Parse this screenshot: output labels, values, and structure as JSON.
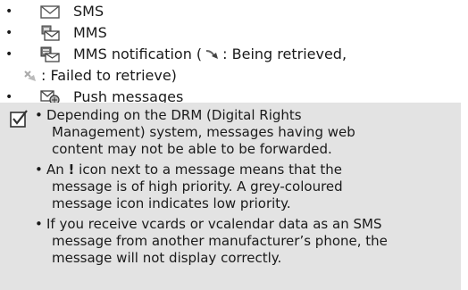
{
  "message_types": [
    {
      "icon": "envelope-icon",
      "label": "SMS"
    },
    {
      "icon": "mms-icon",
      "label": "MMS"
    },
    {
      "icon": "mms-notification-icon",
      "label": "MMS notification (",
      "retrieving_icon": "retrieving-arrow-icon",
      "retrieving_text": ": Being retrieved,",
      "failed_icon": "failed-retrieve-icon",
      "failed_text": ": Failed to retrieve)"
    },
    {
      "icon": "push-message-icon",
      "label": "Push messages"
    }
  ],
  "note": {
    "icon": "checkbox-note-icon",
    "bullets": [
      {
        "lines": [
          "Depending on the DRM (Digital Rights",
          "Management) system, messages having web",
          "content may not be able to be forwarded."
        ]
      },
      {
        "line1_prefix": "An ",
        "line1_mark": "!",
        "line1_suffix": " icon next to a message means that the",
        "lines_rest": [
          "message is of high priority. A grey-coloured",
          "message icon indicates low priority."
        ]
      },
      {
        "lines": [
          "If you receive vcards or vcalendar data as an SMS",
          "message from another manufacturer’s phone, the",
          "message will not display correctly."
        ]
      }
    ]
  }
}
